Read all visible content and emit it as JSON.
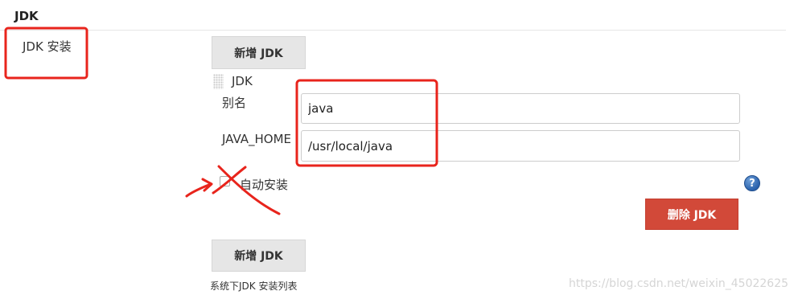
{
  "section": {
    "title": "JDK",
    "row_label": "JDK 安装"
  },
  "buttons": {
    "add_jdk_top": "新增 JDK",
    "add_jdk_bottom": "新增 JDK",
    "delete_jdk": "删除 JDK"
  },
  "installation": {
    "header": "JDK",
    "alias_label": "别名",
    "alias_value": "java",
    "java_home_label": "JAVA_HOME",
    "java_home_value": "/usr/local/java",
    "auto_install_label": "自动安装",
    "auto_install_checked": false
  },
  "help_icon": {
    "glyph": "?",
    "icon": "help-icon"
  },
  "footer": {
    "description": "系统下JDK 安装列表"
  },
  "watermark": "https://blog.csdn.net/weixin_45022625",
  "colors": {
    "annotation_red": "#e8241c",
    "delete_button": "#d24939",
    "gray_button": "#e6e6e6",
    "help_icon": "#2a62ad"
  }
}
